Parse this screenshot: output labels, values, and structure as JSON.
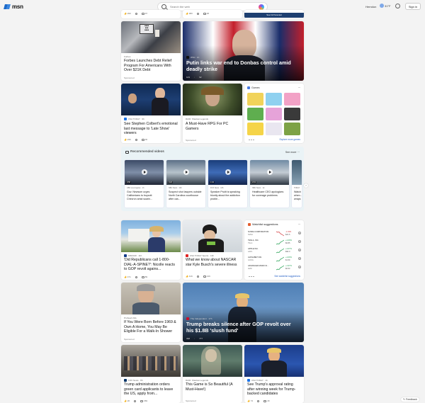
{
  "header": {
    "logo_text": "msn",
    "search_placeholder": "Search the web",
    "location": "Herndon",
    "weather_temp": "31°F",
    "signin_label": "Sign in"
  },
  "top_strip": {
    "left_likes": "290",
    "left_comments": "97",
    "mid_likes": "380",
    "mid_comments": "48",
    "right_button_label": "See full forecast"
  },
  "cards": {
    "forbes": {
      "source": "Forbes",
      "title": "Forbes Launches Debt Relief Program For Americans With Over $21K Debt",
      "sponsored": "Sponsored"
    },
    "putin": {
      "source": "WSJ · 1h",
      "title": "Putin links war end to Donbas control amid deadly strike",
      "likes": "1kS",
      "comments": "92"
    },
    "colbert": {
      "source": "USA TODAY · 9h",
      "title": "See Stephen Colbert's emotional last message to 'Late Show' viewers",
      "likes": "236",
      "comments": "36"
    },
    "rpg": {
      "source": "RAID: Shadow Legends",
      "title": "A Must-Have RPG For PC Gamers",
      "sponsored": "Sponsored"
    },
    "games": {
      "header": "Games",
      "link": "Explore more games",
      "colors": [
        "#f1d35a",
        "#8fd1f0",
        "#f2a2c6",
        "#5fae4f",
        "#e6a3d9",
        "#3a3a3a",
        "#f5d448",
        "#e9e6f0",
        "#7da246"
      ]
    },
    "gop": {
      "source": "MSNOW · 11h",
      "title": "'Did Republicans call 1-800-DIAL-A-SPINE?': Nicolle reacts to GOP revolt agains...",
      "likes": "471",
      "comments": "89"
    },
    "nascar": {
      "source": "USA TODAY Sports · 13h",
      "title": "What we know about NASCAR star Kyle Busch's severe illness",
      "likes": "416",
      "comments": "136"
    },
    "born1969": {
      "source": "ProSeal USA",
      "title": "If You Were Born Before 1969 & Own A Home, You May Be Eligible For a Walk-In Shower",
      "sponsored": "Sponsored"
    },
    "trump_revolt": {
      "source": "The Independent · 17h",
      "title": "Trump breaks silence after GOP revolt over his $1.8B 'slush fund'",
      "likes": "398",
      "comments": "777"
    },
    "green_card": {
      "source": "FOX News · 8h",
      "title": "Trump administration orders green card applicants to leave the US, apply from...",
      "likes": "26",
      "comments": "369"
    },
    "beautiful": {
      "source": "RAID: Shadow Legends",
      "title": "This Game is So Beautiful (A Must-Have!)",
      "sponsored": "Sponsored"
    },
    "approval": {
      "source": "USA TODAY · 1h",
      "title": "See Trump's approval rating after winning week for Trump-backed candidates",
      "likes": "74",
      "comments": "18"
    }
  },
  "videos": {
    "title": "Recommended videos",
    "see_more": "See more",
    "items": [
      {
        "source": "CBS Los Angeles · 1h",
        "title": "Gov. Newsom urges Californians to boycott Chevron amid soarin...",
        "duration": "0:58"
      },
      {
        "source": "NBC News · 12h",
        "title": "Suspect shot lawyers outside North Carolina courthouse after cas...",
        "duration": "0:22"
      },
      {
        "source": "FOX News · 13h",
        "title": "Speaker Pruitt is speaking bluntly about the addiction proble...",
        "duration": "1:04"
      },
      {
        "source": "NBC News · 1d",
        "title": "Healthcare CEO apologizes for coverage problems",
        "duration": "2:19"
      },
      {
        "source": "TODAY",
        "title": "Watch when... wraps",
        "duration": ""
      }
    ]
  },
  "watchlist": {
    "header": "Watchlist suggestions",
    "link": "See watchlist suggestions",
    "rows": [
      {
        "name": "NVIDIA CORPORATION",
        "ticker": "NVDA",
        "value": "-1.03%",
        "change": "$21.5",
        "up": false
      },
      {
        "name": "TESLA, INC.",
        "ticker": "TSLA",
        "value": "+1.09%",
        "change": "$6.85",
        "up": true
      },
      {
        "name": "APPLE INC.",
        "ticker": "AAPL",
        "value": "+1.07%",
        "change": "$94.0",
        "up": true
      },
      {
        "name": "ALPHABET INC.",
        "ticker": "GOOG",
        "value": "+1.00%",
        "change": "$1.59",
        "up": true
      },
      {
        "name": "ADVANCED MICRO D...",
        "ticker": "AMD",
        "value": "+1.97%",
        "change": "$0.53",
        "up": true
      }
    ]
  },
  "feedback_label": "Feedback"
}
